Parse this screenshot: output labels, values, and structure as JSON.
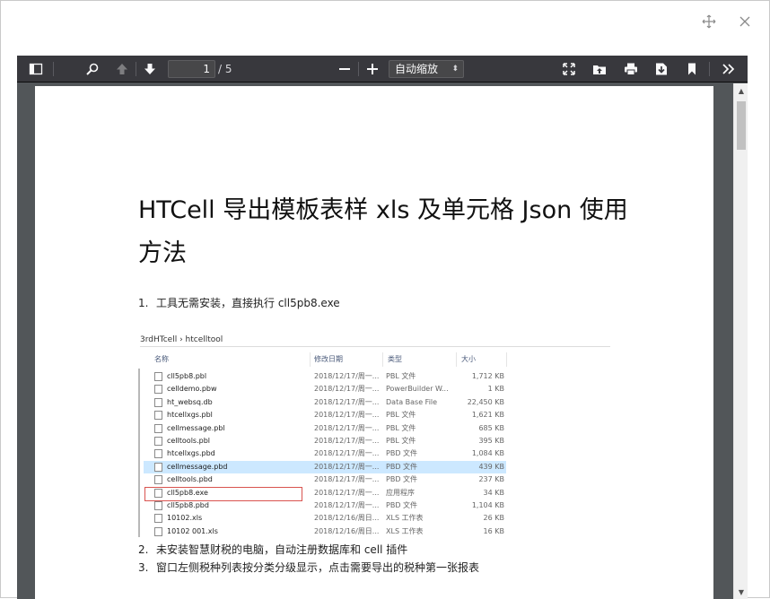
{
  "dialog": {
    "move_icon": "move-icon",
    "close_icon": "close-icon"
  },
  "toolbar": {
    "page_number": "1",
    "page_total": "/ 5",
    "zoom_value": "自动缩放",
    "zoom_minus": "−",
    "zoom_plus": "+"
  },
  "document": {
    "title": "HTCell 导出模板表样 xls 及单元格 Json 使用方法",
    "steps": [
      {
        "num": "1.",
        "text": "工具无需安装，直接执行 cll5pb8.exe"
      },
      {
        "num": "2.",
        "text": "未安装智慧财税的电脑，自动注册数据库和 cell 插件"
      },
      {
        "num": "3.",
        "text": "窗口左侧税种列表按分类分级显示，点击需要导出的税种第一张报表"
      }
    ]
  },
  "explorer": {
    "breadcrumb": "3rdHTcell  ›  htcelltool",
    "headers": {
      "name": "名称",
      "date": "修改日期",
      "type": "类型",
      "size": "大小"
    },
    "files": [
      {
        "name": "cll5pb8.pbl",
        "date": "2018/12/17/周一...",
        "type": "PBL 文件",
        "size": "1,712 KB"
      },
      {
        "name": "celldemo.pbw",
        "date": "2018/12/17/周一...",
        "type": "PowerBuilder W...",
        "size": "1 KB"
      },
      {
        "name": "ht_websq.db",
        "date": "2018/12/17/周一...",
        "type": "Data Base File",
        "size": "22,450 KB"
      },
      {
        "name": "htcellxgs.pbl",
        "date": "2018/12/17/周一...",
        "type": "PBL 文件",
        "size": "1,621 KB"
      },
      {
        "name": "cellmessage.pbl",
        "date": "2018/12/17/周一...",
        "type": "PBL 文件",
        "size": "685 KB"
      },
      {
        "name": "celltools.pbl",
        "date": "2018/12/17/周一...",
        "type": "PBL 文件",
        "size": "395 KB"
      },
      {
        "name": "htcellxgs.pbd",
        "date": "2018/12/17/周一...",
        "type": "PBD 文件",
        "size": "1,084 KB"
      },
      {
        "name": "cellmessage.pbd",
        "date": "2018/12/17/周一...",
        "type": "PBD 文件",
        "size": "439 KB"
      },
      {
        "name": "celltools.pbd",
        "date": "2018/12/17/周一...",
        "type": "PBD 文件",
        "size": "237 KB"
      },
      {
        "name": "cll5pb8.exe",
        "date": "2018/12/17/周一...",
        "type": "应用程序",
        "size": "34 KB"
      },
      {
        "name": "cll5pb8.pbd",
        "date": "2018/12/17/周一...",
        "type": "PBD 文件",
        "size": "1,104 KB"
      },
      {
        "name": "10102.xls",
        "date": "2018/12/16/周日...",
        "type": "XLS 工作表",
        "size": "26 KB"
      },
      {
        "name": "10102 001.xls",
        "date": "2018/12/16/周日...",
        "type": "XLS 工作表",
        "size": "16 KB"
      }
    ],
    "selected_index": 7,
    "highlighted_index": 9
  },
  "colors": {
    "toolbar_bg": "#38383d",
    "viewer_bg": "#525659",
    "selection": "#cce8ff",
    "highlight_box": "#d9534f"
  }
}
